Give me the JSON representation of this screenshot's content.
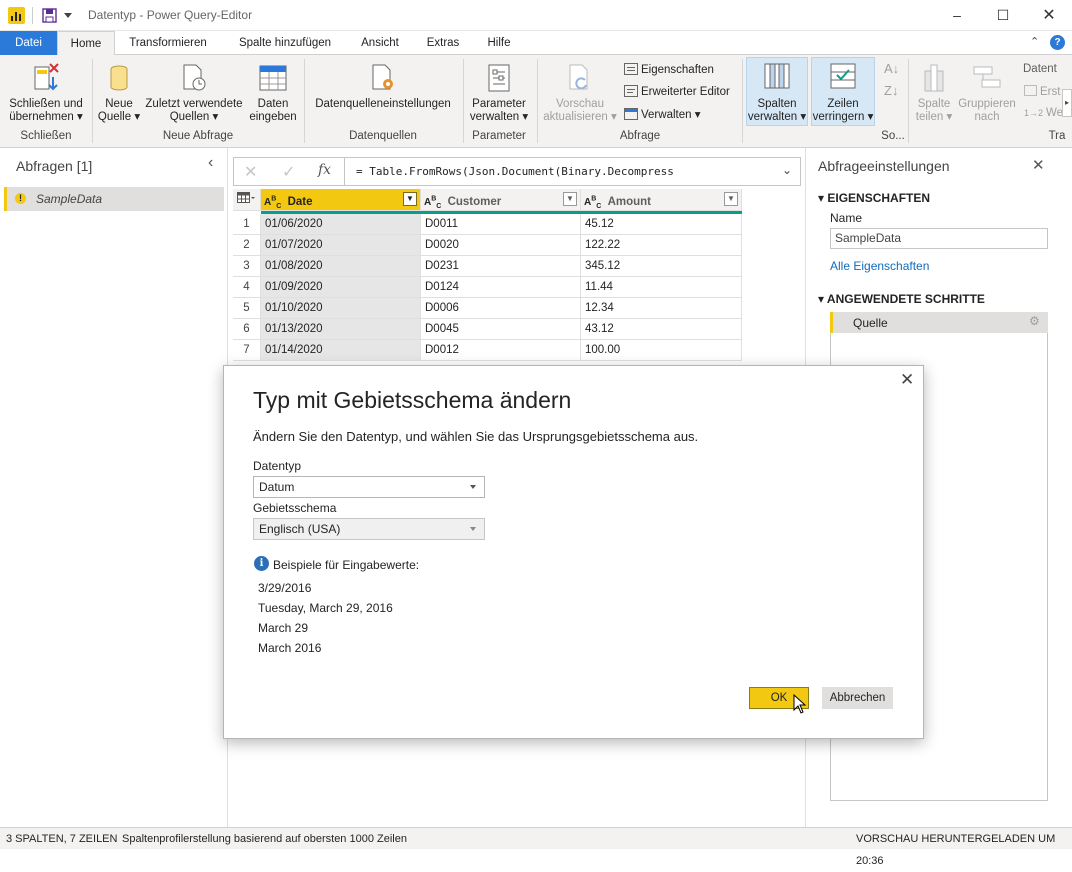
{
  "window": {
    "title": "Datentyp - Power Query-Editor"
  },
  "tabs": [
    "Datei",
    "Home",
    "Transformieren",
    "Spalte hinzufügen",
    "Ansicht",
    "Extras",
    "Hilfe"
  ],
  "ribbon": {
    "close_apply_1": "Schließen und",
    "close_apply_2": "übernehmen",
    "new_source_1": "Neue",
    "new_source_2": "Quelle",
    "recent_1": "Zuletzt verwendete",
    "recent_2": "Quellen",
    "enter_data_1": "Daten",
    "enter_data_2": "eingeben",
    "ds_settings": "Datenquelleneinstellungen",
    "params_1": "Parameter",
    "params_2": "verwalten",
    "refresh_1": "Vorschau",
    "refresh_2": "aktualisieren",
    "properties": "Eigenschaften",
    "adv_editor": "Erweiterter Editor",
    "manage": "Verwalten",
    "cols_1": "Spalten",
    "cols_2": "verwalten",
    "rows_1": "Zeilen",
    "rows_2": "verringern",
    "split_1": "Spalte",
    "split_2": "teilen",
    "group_1": "Gruppieren",
    "group_2": "nach",
    "datatype_trunc": "Datent",
    "erst_trunc": "Erst",
    "we_trunc": "We",
    "groups": {
      "close": "Schließen",
      "new_query": "Neue Abfrage",
      "data_sources": "Datenquellen",
      "parameters": "Parameter",
      "query": "Abfrage",
      "sort_trunc": "So...",
      "tra_trunc": "Tra"
    }
  },
  "left_pane": {
    "title": "Abfragen [1]",
    "query": "SampleData"
  },
  "formula": {
    "text": "= Table.FromRows(Json.Document(Binary.Decompress"
  },
  "table": {
    "columns": [
      "Date",
      "Customer",
      "Amount"
    ],
    "rows": [
      [
        "1",
        "01/06/2020",
        "D0011",
        "45.12"
      ],
      [
        "2",
        "01/07/2020",
        "D0020",
        "122.22"
      ],
      [
        "3",
        "01/08/2020",
        "D0231",
        "345.12"
      ],
      [
        "4",
        "01/09/2020",
        "D0124",
        "11.44"
      ],
      [
        "5",
        "01/10/2020",
        "D0006",
        "12.34"
      ],
      [
        "6",
        "01/13/2020",
        "D0045",
        "43.12"
      ],
      [
        "7",
        "01/14/2020",
        "D0012",
        "100.00"
      ]
    ]
  },
  "right_pane": {
    "title": "Abfrageeinstellungen",
    "properties_header": "EIGENSCHAFTEN",
    "name_label": "Name",
    "name_value": "SampleData",
    "all_props": "Alle Eigenschaften",
    "steps_header": "ANGEWENDETE SCHRITTE",
    "step_1": "Quelle"
  },
  "dialog": {
    "title": "Typ mit Gebietsschema ändern",
    "description": "Ändern Sie den Datentyp, und wählen Sie das Ursprungsgebietsschema aus.",
    "datatype_label": "Datentyp",
    "datatype_value": "Datum",
    "locale_label": "Gebietsschema",
    "locale_value": "Englisch (USA)",
    "examples_label": "Beispiele für Eingabewerte:",
    "examples": [
      "3/29/2016",
      "Tuesday, March 29, 2016",
      "March 29",
      "March 2016"
    ],
    "ok": "OK",
    "cancel": "Abbrechen"
  },
  "status": {
    "left": "3 SPALTEN, 7 ZEILEN",
    "middle": "Spaltenprofilerstellung basierend auf obersten 1000 Zeilen",
    "right": "VORSCHAU HERUNTERGELADEN UM 20:36"
  },
  "colors": {
    "accent_blue": "#2b79d8",
    "pbi_yellow": "#f2c811",
    "teal_bar": "#0b9d8c",
    "link_blue": "#0f6cbd"
  }
}
